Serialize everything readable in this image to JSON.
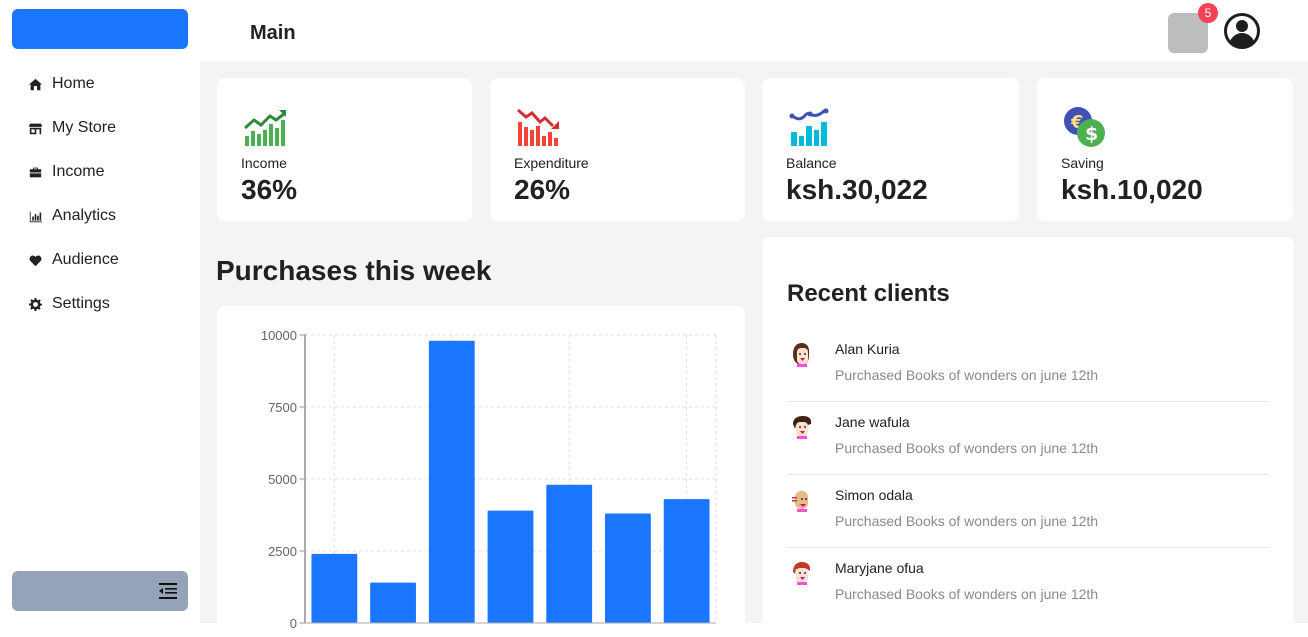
{
  "sidebar": {
    "items": [
      {
        "label": "Home",
        "icon": "home-icon"
      },
      {
        "label": "My Store",
        "icon": "store-icon"
      },
      {
        "label": "Income",
        "icon": "briefcase-icon"
      },
      {
        "label": "Analytics",
        "icon": "bar-chart-icon"
      },
      {
        "label": "Audience",
        "icon": "heart-icon"
      },
      {
        "label": "Settings",
        "icon": "gear-icon"
      }
    ],
    "collapse_icon": "collapse-menu-icon"
  },
  "header": {
    "title": "Main",
    "notification_count": "5"
  },
  "stats": [
    {
      "label": "Income",
      "value": "36%",
      "icon": "trending-up-chart-icon"
    },
    {
      "label": "Expenditure",
      "value": "26%",
      "icon": "trending-down-chart-icon"
    },
    {
      "label": "Balance",
      "value": "ksh.30,022",
      "icon": "balance-chart-icon"
    },
    {
      "label": "Saving",
      "value": "ksh.10,020",
      "icon": "currency-coins-icon"
    }
  ],
  "purchases": {
    "title": "Purchases this week"
  },
  "chart_data": {
    "type": "bar",
    "title": "",
    "xlabel": "",
    "ylabel": "",
    "categories": [
      "",
      "",
      "",
      "",
      "",
      "",
      ""
    ],
    "values": [
      2400,
      1400,
      9800,
      3900,
      4800,
      3800,
      4300
    ],
    "ylim": [
      0,
      10000
    ],
    "yticks": [
      "0",
      "2500",
      "5000",
      "7500",
      "10000"
    ],
    "grid": true,
    "color": "#1a76ff"
  },
  "clients": {
    "title": "Recent clients",
    "items": [
      {
        "name": "Alan Kuria",
        "desc": "Purchased Books of wonders on june 12th",
        "hair": "#5a2f1a"
      },
      {
        "name": "Jane wafula",
        "desc": "Purchased Books of wonders on june 12th",
        "hair": "#3d2314"
      },
      {
        "name": "Simon odala",
        "desc": "Purchased Books of wonders on june 12th",
        "hair": "#e8b98a"
      },
      {
        "name": "Maryjane ofua",
        "desc": "Purchased Books of wonders on june 12th",
        "hair": "#c0392b"
      }
    ]
  },
  "colors": {
    "accent": "#1a76ff",
    "income": "#4caf50",
    "expenditure": "#f44336",
    "balance": "#00bcd4",
    "badge": "#f44352"
  }
}
